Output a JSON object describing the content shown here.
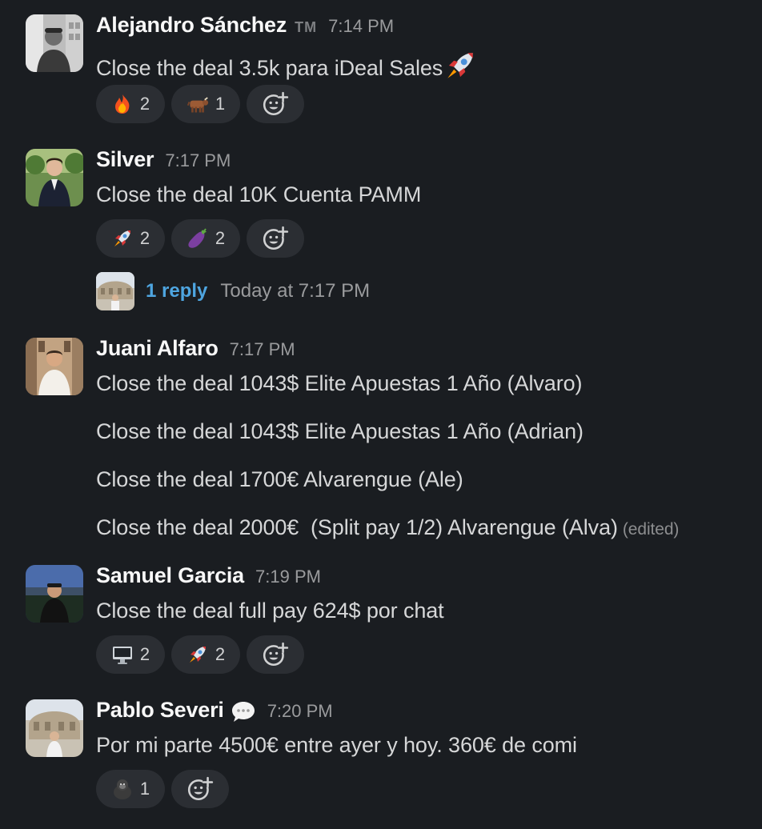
{
  "messages": [
    {
      "name": "Alejandro Sánchez",
      "badge": "TM",
      "time": "7:14 PM",
      "lines": [
        "Close the deal 3.5k para iDeal Sales"
      ],
      "reactions": [
        {
          "emoji": "fire-emoji",
          "count": "2"
        },
        {
          "emoji": "ox-emoji",
          "count": "1"
        }
      ]
    },
    {
      "name": "Silver",
      "time": "7:17 PM",
      "lines": [
        "Close the deal 10K Cuenta PAMM"
      ],
      "reactions": [
        {
          "emoji": "rocket-emoji",
          "count": "2"
        },
        {
          "emoji": "eggplant-emoji",
          "count": "2"
        }
      ],
      "thread": {
        "reply_count": "1 reply",
        "last_reply": "Today at 7:17 PM"
      }
    },
    {
      "name": "Juani Alfaro",
      "time": "7:17 PM",
      "lines": [
        "Close the deal 1043$ Elite Apuestas 1 Año (Alvaro)",
        "Close the deal 1043$ Elite Apuestas 1 Año (Adrian)",
        "Close the deal 1700€ Alvarengue (Ale)",
        "Close the deal 2000€  (Split pay 1/2) Alvarengue (Alva)"
      ],
      "edited_label": "(edited)"
    },
    {
      "name": "Samuel Garcia",
      "time": "7:19 PM",
      "lines": [
        "Close the deal full pay 624$ por chat"
      ],
      "reactions": [
        {
          "emoji": "desktop-computer-emoji",
          "count": "2"
        },
        {
          "emoji": "rocket-emoji",
          "count": "2"
        }
      ]
    },
    {
      "name": "Pablo Severi",
      "status_icon": "speech-bubble-icon",
      "time": "7:20 PM",
      "lines": [
        "Por mi parte 4500€ entre ayer y hoy. 360€ de comi"
      ],
      "reactions": [
        {
          "emoji": "gorilla-emoji",
          "count": "1"
        }
      ]
    }
  ],
  "colors": {
    "background": "#1a1d21",
    "reaction_pill": "#2b2e33",
    "link": "#4ea5e0",
    "name": "#f8f8f8",
    "timestamp": "#9a9b9d"
  }
}
